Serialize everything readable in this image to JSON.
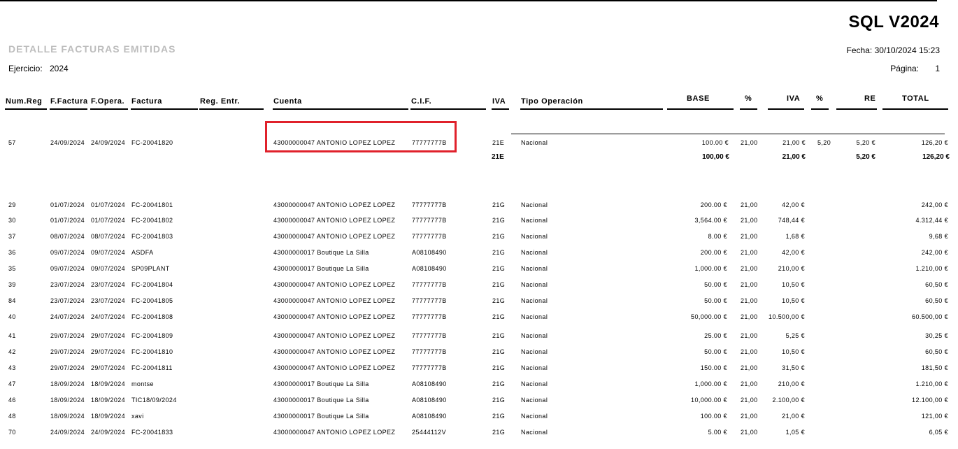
{
  "header": {
    "product": "SQL V2024",
    "report_title": "DETALLE FACTURAS EMITIDAS",
    "fecha": "Fecha: 30/10/2024  15:23",
    "ejercicio_label": "Ejercicio:",
    "ejercicio_value": "2024",
    "pagina_label": "Página:",
    "pagina_value": "1"
  },
  "columns": {
    "numreg": "Num.Reg",
    "ffactura": "F.Factura",
    "fopera": "F.Opera.",
    "factura": "Factura",
    "regentr": "Reg. Entr.",
    "cuenta": "Cuenta",
    "cif": "C.I.F.",
    "iva": "IVA",
    "tipo": "Tipo Operación",
    "base": "BASE",
    "pct1": "%",
    "iva2": "IVA",
    "pct2": "%",
    "re": "RE",
    "total": "TOTAL"
  },
  "group_21E": {
    "row": {
      "numreg": "57",
      "ffactura": "24/09/2024",
      "fopera": "24/09/2024",
      "factura": "FC-20041820",
      "cuenta": "43000000047 ANTONIO LOPEZ LOPEZ",
      "cif": "77777777B",
      "iva": "21E",
      "tipo": "Nacional",
      "base": "100.00 €",
      "pct": "21,00",
      "cuota": "21,00 €",
      "pctre": "5,20",
      "re": "5,20 €",
      "total": "126,20 €"
    },
    "subtotal": {
      "iva": "21E",
      "base": "100,00 €",
      "cuota": "21,00 €",
      "re": "5,20 €",
      "total": "126,20 €"
    }
  },
  "rows": [
    {
      "numreg": "29",
      "ffactura": "01/07/2024",
      "fopera": "01/07/2024",
      "factura": "FC-20041801",
      "cuenta": "43000000047 ANTONIO LOPEZ LOPEZ",
      "cif": "77777777B",
      "iva": "21G",
      "tipo": "Nacional",
      "base": "200.00 €",
      "pct": "21,00",
      "cuota": "42,00 €",
      "total": "242,00 €"
    },
    {
      "numreg": "30",
      "ffactura": "01/07/2024",
      "fopera": "01/07/2024",
      "factura": "FC-20041802",
      "cuenta": "43000000047 ANTONIO LOPEZ LOPEZ",
      "cif": "77777777B",
      "iva": "21G",
      "tipo": "Nacional",
      "base": "3,564.00 €",
      "pct": "21,00",
      "cuota": "748,44 €",
      "total": "4.312,44 €"
    },
    {
      "numreg": "37",
      "ffactura": "08/07/2024",
      "fopera": "08/07/2024",
      "factura": "FC-20041803",
      "cuenta": "43000000047 ANTONIO LOPEZ LOPEZ",
      "cif": "77777777B",
      "iva": "21G",
      "tipo": "Nacional",
      "base": "8.00 €",
      "pct": "21,00",
      "cuota": "1,68 €",
      "total": "9,68 €"
    },
    {
      "numreg": "36",
      "ffactura": "09/07/2024",
      "fopera": "09/07/2024",
      "factura": "ASDFA",
      "cuenta": "43000000017 Boutique La Silla",
      "cif": "A08108490",
      "iva": "21G",
      "tipo": "Nacional",
      "base": "200.00 €",
      "pct": "21,00",
      "cuota": "42,00 €",
      "total": "242,00 €"
    },
    {
      "numreg": "35",
      "ffactura": "09/07/2024",
      "fopera": "09/07/2024",
      "factura": "SP09PLANT",
      "cuenta": "43000000017 Boutique La Silla",
      "cif": "A08108490",
      "iva": "21G",
      "tipo": "Nacional",
      "base": "1,000.00 €",
      "pct": "21,00",
      "cuota": "210,00 €",
      "total": "1.210,00 €"
    },
    {
      "numreg": "39",
      "ffactura": "23/07/2024",
      "fopera": "23/07/2024",
      "factura": "FC-20041804",
      "cuenta": "43000000047 ANTONIO LOPEZ LOPEZ",
      "cif": "77777777B",
      "iva": "21G",
      "tipo": "Nacional",
      "base": "50.00 €",
      "pct": "21,00",
      "cuota": "10,50 €",
      "total": "60,50 €"
    },
    {
      "numreg": "84",
      "ffactura": "23/07/2024",
      "fopera": "23/07/2024",
      "factura": "FC-20041805",
      "cuenta": "43000000047 ANTONIO LOPEZ LOPEZ",
      "cif": "77777777B",
      "iva": "21G",
      "tipo": "Nacional",
      "base": "50.00 €",
      "pct": "21,00",
      "cuota": "10,50 €",
      "total": "60,50 €"
    },
    {
      "numreg": "40",
      "ffactura": "24/07/2024",
      "fopera": "24/07/2024",
      "factura": "FC-20041808",
      "cuenta": "43000000047 ANTONIO LOPEZ LOPEZ",
      "cif": "77777777B",
      "iva": "21G",
      "tipo": "Nacional",
      "base": "50,000.00 €",
      "pct": "21,00",
      "cuota": "10.500,00 €",
      "total": "60.500,00 €"
    },
    {
      "numreg": "41",
      "ffactura": "29/07/2024",
      "fopera": "29/07/2024",
      "factura": "FC-20041809",
      "cuenta": "43000000047 ANTONIO LOPEZ LOPEZ",
      "cif": "77777777B",
      "iva": "21G",
      "tipo": "Nacional",
      "base": "25.00 €",
      "pct": "21,00",
      "cuota": "5,25 €",
      "total": "30,25 €"
    },
    {
      "numreg": "42",
      "ffactura": "29/07/2024",
      "fopera": "29/07/2024",
      "factura": "FC-20041810",
      "cuenta": "43000000047 ANTONIO LOPEZ LOPEZ",
      "cif": "77777777B",
      "iva": "21G",
      "tipo": "Nacional",
      "base": "50.00 €",
      "pct": "21,00",
      "cuota": "10,50 €",
      "total": "60,50 €"
    },
    {
      "numreg": "43",
      "ffactura": "29/07/2024",
      "fopera": "29/07/2024",
      "factura": "FC-20041811",
      "cuenta": "43000000047 ANTONIO LOPEZ LOPEZ",
      "cif": "77777777B",
      "iva": "21G",
      "tipo": "Nacional",
      "base": "150.00 €",
      "pct": "21,00",
      "cuota": "31,50 €",
      "total": "181,50 €"
    },
    {
      "numreg": "47",
      "ffactura": "18/09/2024",
      "fopera": "18/09/2024",
      "factura": "montse",
      "cuenta": "43000000017 Boutique La Silla",
      "cif": "A08108490",
      "iva": "21G",
      "tipo": "Nacional",
      "base": "1,000.00 €",
      "pct": "21,00",
      "cuota": "210,00 €",
      "total": "1.210,00 €"
    },
    {
      "numreg": "46",
      "ffactura": "18/09/2024",
      "fopera": "18/09/2024",
      "factura": "TIC18/09/2024",
      "cuenta": "43000000017 Boutique La Silla",
      "cif": "A08108490",
      "iva": "21G",
      "tipo": "Nacional",
      "base": "10,000.00 €",
      "pct": "21,00",
      "cuota": "2.100,00 €",
      "total": "12.100,00 €"
    },
    {
      "numreg": "48",
      "ffactura": "18/09/2024",
      "fopera": "18/09/2024",
      "factura": "xavi",
      "cuenta": "43000000017 Boutique La Silla",
      "cif": "A08108490",
      "iva": "21G",
      "tipo": "Nacional",
      "base": "100.00 €",
      "pct": "21,00",
      "cuota": "21,00 €",
      "total": "121,00 €"
    },
    {
      "numreg": "70",
      "ffactura": "24/09/2024",
      "fopera": "24/09/2024",
      "factura": "FC-20041833",
      "cuenta": "43000000047 ANTONIO LOPEZ LOPEZ",
      "cif": "25444112V",
      "iva": "21G",
      "tipo": "Nacional",
      "base": "5.00 €",
      "pct": "21,00",
      "cuota": "1,05 €",
      "total": "6,05 €"
    }
  ]
}
